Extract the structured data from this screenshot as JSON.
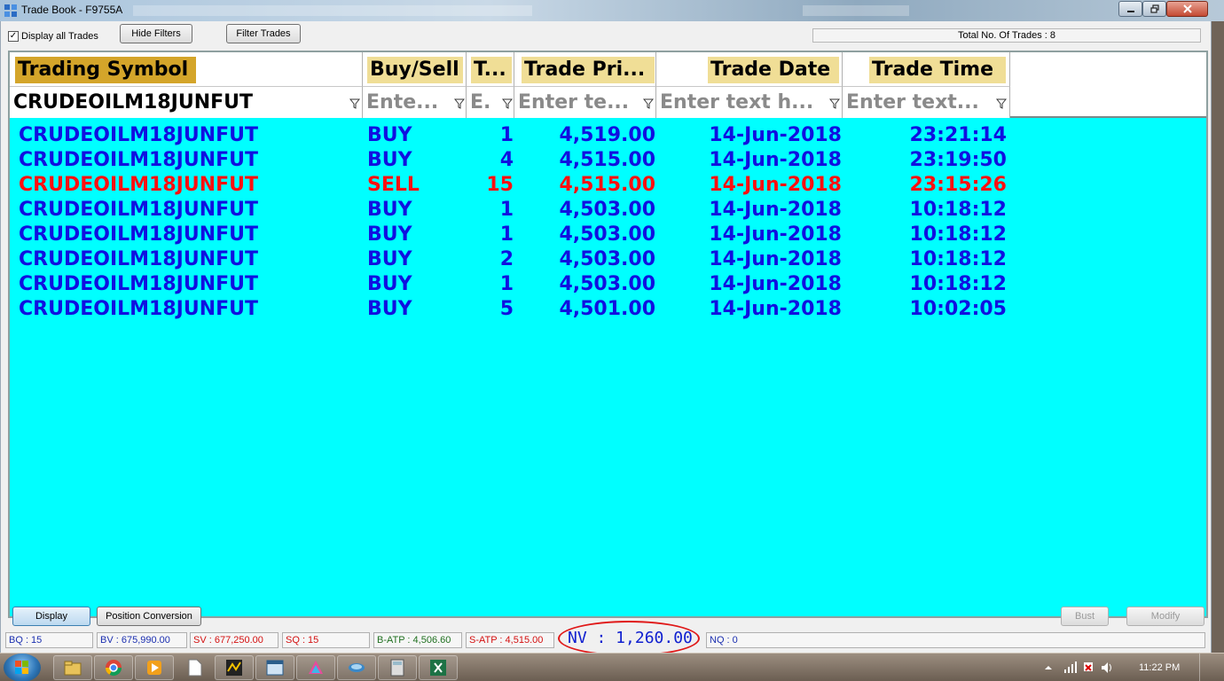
{
  "window": {
    "title": "Trade Book - F9755A"
  },
  "toolbar": {
    "display_all_label": "Display all Trades",
    "display_all_checked": true,
    "hide_filters_label": "Hide Filters",
    "filter_trades_label": "Filter Trades",
    "total_trades": "Total No. Of Trades : 8"
  },
  "grid": {
    "columns": [
      {
        "header": "Trading Symbol",
        "filter_value": "CRUDEOILM18JUNFUT",
        "header_bg": "#d4a52a"
      },
      {
        "header": "Buy/Sell",
        "filter_placeholder": "Ente...",
        "header_bg": "#f0de96"
      },
      {
        "header": "T...",
        "filter_placeholder": "E.",
        "header_bg": "#f0de96"
      },
      {
        "header": "Trade Pri...",
        "filter_placeholder": "Enter te...",
        "header_bg": "#f0de96"
      },
      {
        "header": "Trade Date",
        "filter_placeholder": "Enter text h...",
        "header_bg": "#f0de96"
      },
      {
        "header": "Trade Time",
        "filter_placeholder": "Enter text...",
        "header_bg": "#f0de96"
      }
    ],
    "rows": [
      {
        "symbol": "CRUDEOILM18JUNFUT",
        "side": "BUY",
        "qty": "1",
        "price": "4,519.00",
        "date": "14-Jun-2018",
        "time": "23:21:14",
        "color": "#1010e0"
      },
      {
        "symbol": "CRUDEOILM18JUNFUT",
        "side": "BUY",
        "qty": "4",
        "price": "4,515.00",
        "date": "14-Jun-2018",
        "time": "23:19:50",
        "color": "#1010e0"
      },
      {
        "symbol": "CRUDEOILM18JUNFUT",
        "side": "SELL",
        "qty": "15",
        "price": "4,515.00",
        "date": "14-Jun-2018",
        "time": "23:15:26",
        "color": "#ff1010"
      },
      {
        "symbol": "CRUDEOILM18JUNFUT",
        "side": "BUY",
        "qty": "1",
        "price": "4,503.00",
        "date": "14-Jun-2018",
        "time": "10:18:12",
        "color": "#1010e0"
      },
      {
        "symbol": "CRUDEOILM18JUNFUT",
        "side": "BUY",
        "qty": "1",
        "price": "4,503.00",
        "date": "14-Jun-2018",
        "time": "10:18:12",
        "color": "#1010e0"
      },
      {
        "symbol": "CRUDEOILM18JUNFUT",
        "side": "BUY",
        "qty": "2",
        "price": "4,503.00",
        "date": "14-Jun-2018",
        "time": "10:18:12",
        "color": "#1010e0"
      },
      {
        "symbol": "CRUDEOILM18JUNFUT",
        "side": "BUY",
        "qty": "1",
        "price": "4,503.00",
        "date": "14-Jun-2018",
        "time": "10:18:12",
        "color": "#1010e0"
      },
      {
        "symbol": "CRUDEOILM18JUNFUT",
        "side": "BUY",
        "qty": "5",
        "price": "4,501.00",
        "date": "14-Jun-2018",
        "time": "10:02:05",
        "color": "#1010e0"
      }
    ],
    "background": "#00ffff"
  },
  "bottom": {
    "display_label": "Display",
    "position_conversion_label": "Position Conversion",
    "bust_label": "Bust",
    "modify_label": "Modify"
  },
  "status": {
    "bq": "BQ : 15",
    "bv": "BV : 675,990.00",
    "sv": "SV : 677,250.00",
    "sq": "SQ : 15",
    "batp": "B-ATP : 4,506.60",
    "satp": "S-ATP : 4,515.00",
    "nv": "NV : 1,260.00",
    "nq": "NQ : 0"
  },
  "taskbar": {
    "clock": "11:22 PM",
    "icons": [
      "windows-explorer-icon",
      "chrome-icon",
      "media-player-icon",
      "document-icon",
      "trading-app-icon",
      "window-icon",
      "paint-icon",
      "network-icon",
      "calculator-icon",
      "excel-icon"
    ]
  }
}
